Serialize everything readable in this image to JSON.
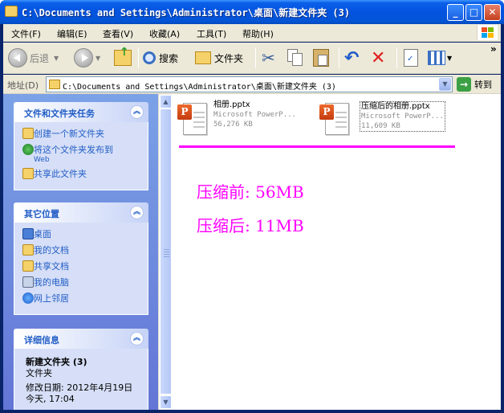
{
  "window": {
    "title": "C:\\Documents and Settings\\Administrator\\桌面\\新建文件夹 (3)",
    "minimize": "_",
    "maximize": "□",
    "close": "✕"
  },
  "menu": [
    "文件(F)",
    "编辑(E)",
    "查看(V)",
    "收藏(A)",
    "工具(T)",
    "帮助(H)"
  ],
  "toolbar": {
    "back_label": "后退",
    "search_label": "搜索",
    "folders_label": "文件夹",
    "more_glyph": "»"
  },
  "address": {
    "label": "地址(D)",
    "value": "C:\\Documents and Settings\\Administrator\\桌面\\新建文件夹 (3)",
    "go_label": "转到"
  },
  "tasks_panel": {
    "title": "文件和文件夹任务",
    "items": [
      "创建一个新文件夹",
      "将这个文件夹发布到",
      "共享此文件夹"
    ],
    "web_suffix": "Web"
  },
  "places_panel": {
    "title": "其它位置",
    "items": [
      "桌面",
      "我的文档",
      "共享文档",
      "我的电脑",
      "网上邻居"
    ]
  },
  "details_panel": {
    "title": "详细信息",
    "name": "新建文件夹 (3)",
    "type": "文件夹",
    "modified": "修改日期: 2012年4月19日",
    "modified_time": "今天, 17:04"
  },
  "files": [
    {
      "name": "相册.pptx",
      "type": "Microsoft PowerP...",
      "size": "56,276 KB"
    },
    {
      "name": "压缩后的相册.pptx",
      "type": "Microsoft PowerP...",
      "size": "11,609 KB"
    }
  ],
  "notes": {
    "before": "压缩前: 56MB",
    "after": "压缩后: 11MB"
  },
  "colors": {
    "titlebar": "#0453e0",
    "annotation": "#ff00ff",
    "link": "#215dc6"
  }
}
